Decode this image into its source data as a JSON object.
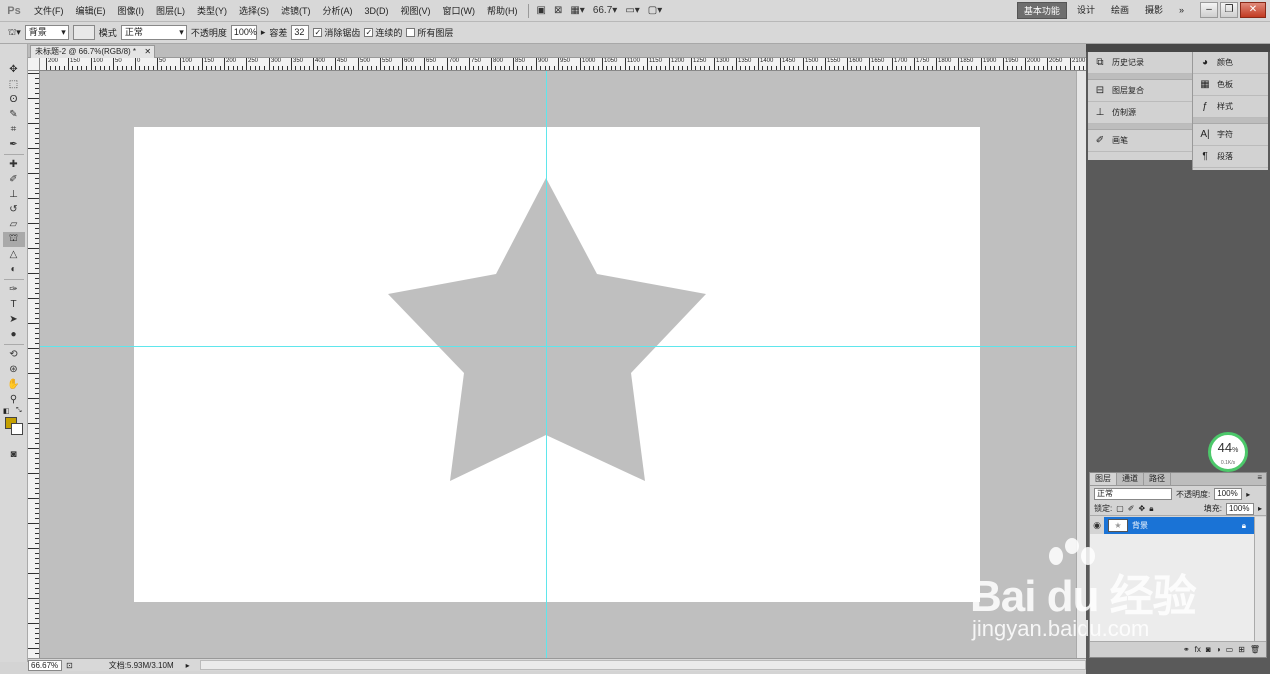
{
  "app": {
    "logo": "Ps",
    "menu": [
      "文件(F)",
      "编辑(E)",
      "图像(I)",
      "图层(L)",
      "类型(Y)",
      "选择(S)",
      "滤镜(T)",
      "分析(A)",
      "3D(D)",
      "视图(V)",
      "窗口(W)",
      "帮助(H)"
    ],
    "zoom_display": "66.7",
    "workspaces": [
      "基本功能",
      "设计",
      "绘画",
      "摄影"
    ],
    "workspace_more": "»"
  },
  "options": {
    "mode_label": "背景",
    "style_label": "模式",
    "style_value": "正常",
    "opacity_label": "不透明度",
    "opacity_value": "100%",
    "tolerance_label": "容差",
    "tolerance_value": "32",
    "antialias_label": "消除锯齿",
    "contiguous_label": "连续的",
    "all_layers_label": "所有图层"
  },
  "document": {
    "tab_title": "未标题-2 @ 66.7%(RGB/8) *",
    "ruler_labels": [
      "200",
      "150",
      "100",
      "50",
      "0",
      "50",
      "100",
      "150",
      "200",
      "250",
      "300",
      "350",
      "400",
      "450",
      "500",
      "550",
      "600",
      "650",
      "700",
      "750",
      "800",
      "850",
      "900",
      "950",
      "1000",
      "1050",
      "1100",
      "1150",
      "1200",
      "1250",
      "1300",
      "1350",
      "1400",
      "1450",
      "1500",
      "1550",
      "1600",
      "1650",
      "1700",
      "1750",
      "1800",
      "1850",
      "1900",
      "1950",
      "2000",
      "2050",
      "2100"
    ],
    "status_zoom": "66.67%",
    "status_info": "文档:5.93M/3.10M"
  },
  "panels": {
    "col1": [
      "历史记录",
      "图层复合",
      "仿制源",
      "画笔"
    ],
    "col2": [
      "颜色",
      "色板",
      "样式",
      "字符",
      "段落"
    ]
  },
  "layers": {
    "tabs": [
      "图层",
      "通道",
      "路径"
    ],
    "blend_mode": "正常",
    "opacity_label": "不透明度:",
    "opacity_value": "100%",
    "lock_label": "锁定:",
    "fill_label": "填充:",
    "fill_value": "100%",
    "layer_name": "背景"
  },
  "net_meter": {
    "percent": "44",
    "unit": "%",
    "speed": "0.1K/s"
  },
  "watermark": {
    "brand": "Bai du 经验",
    "url": "jingyan.baidu.com"
  }
}
